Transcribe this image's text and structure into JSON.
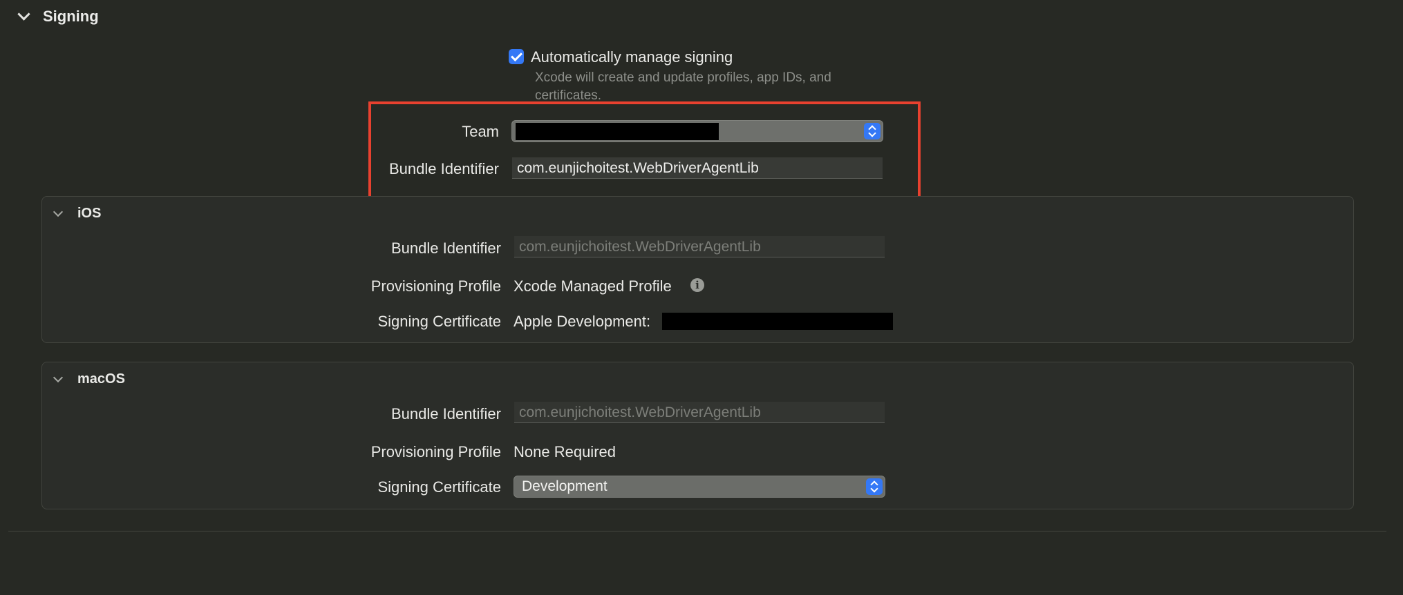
{
  "signing": {
    "section_title": "Signing",
    "auto_manage": {
      "label": "Automatically manage signing",
      "checked": true,
      "help": "Xcode will create and update profiles, app IDs, and certificates."
    },
    "team": {
      "label": "Team",
      "value": ""
    },
    "bundle_identifier": {
      "label": "Bundle Identifier",
      "value": "com.eunjichoitest.WebDriverAgentLib"
    }
  },
  "ios": {
    "title": "iOS",
    "bundle_identifier_label": "Bundle Identifier",
    "bundle_identifier_value": "com.eunjichoitest.WebDriverAgentLib",
    "provisioning_profile_label": "Provisioning Profile",
    "provisioning_profile_value": "Xcode Managed Profile",
    "signing_certificate_label": "Signing Certificate",
    "signing_certificate_value": "Apple Development:"
  },
  "macos": {
    "title": "macOS",
    "bundle_identifier_label": "Bundle Identifier",
    "bundle_identifier_value": "com.eunjichoitest.WebDriverAgentLib",
    "provisioning_profile_label": "Provisioning Profile",
    "provisioning_profile_value": "None Required",
    "signing_certificate_label": "Signing Certificate",
    "signing_certificate_value": "Development"
  },
  "colors": {
    "accent": "#3478f6",
    "highlight": "#e8412f",
    "background": "#272924"
  },
  "icons": {
    "section_toggle": "chevron-down-icon",
    "checkbox": "checkmark-icon",
    "info": "info-icon",
    "popup": "up-down-arrows-icon"
  }
}
